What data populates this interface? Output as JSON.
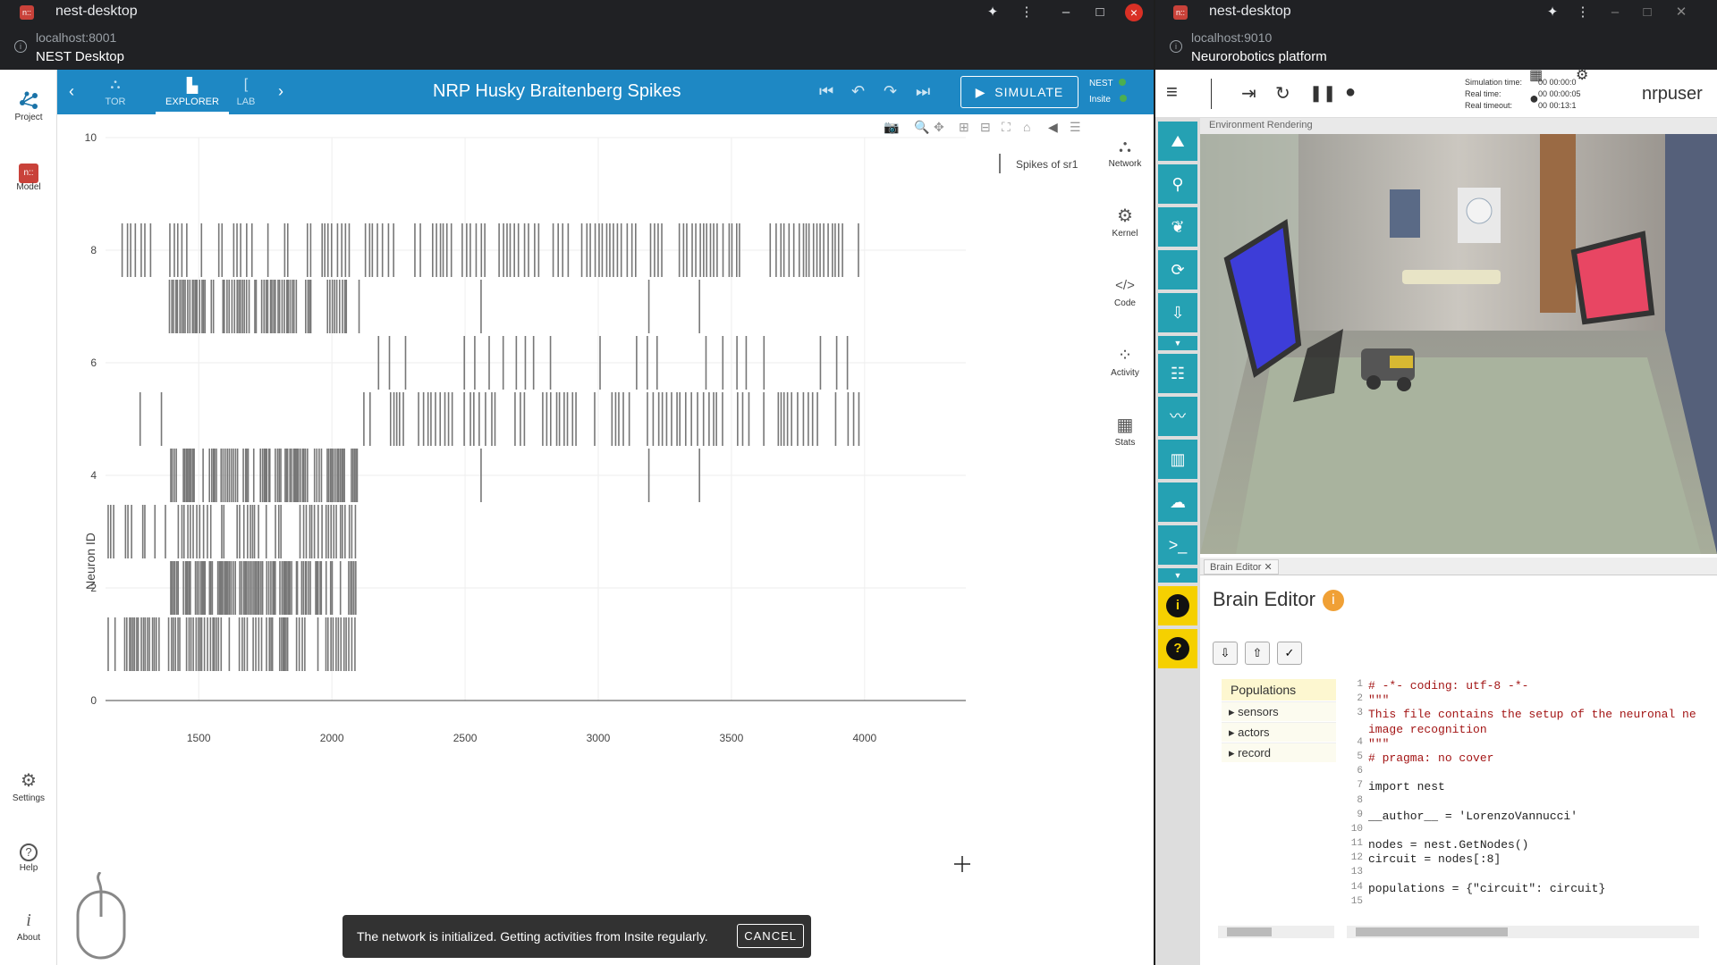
{
  "left_window": {
    "title": "nest-desktop",
    "host": "localhost:8001",
    "subtitle": "NEST Desktop",
    "rail": [
      {
        "label": "Project",
        "icon": "network-icon"
      },
      {
        "label": "Model",
        "icon": "nest-logo-icon"
      },
      {
        "label": "Settings",
        "icon": "gear-icon"
      },
      {
        "label": "Help",
        "icon": "help-icon"
      },
      {
        "label": "About",
        "icon": "info-icon"
      }
    ],
    "toolbar": {
      "nav": [
        {
          "label": "TOR"
        },
        {
          "label": "EXPLORER"
        },
        {
          "label": "LAB"
        }
      ],
      "title": "NRP Husky Braitenberg Spikes",
      "simulate": "SIMULATE",
      "status": [
        {
          "label": "NEST",
          "color": "#4caf50"
        },
        {
          "label": "Insite",
          "color": "#4caf50"
        }
      ]
    },
    "side_panel": [
      {
        "label": "Network",
        "icon": "network-icon"
      },
      {
        "label": "Kernel",
        "icon": "engine-icon"
      },
      {
        "label": "Code",
        "icon": "code-icon"
      },
      {
        "label": "Activity",
        "icon": "scatter-plot-icon"
      },
      {
        "label": "Stats",
        "icon": "table-icon"
      }
    ],
    "snackbar": {
      "message": "The network is initialized. Getting activities from Insite regularly.",
      "action": "CANCEL"
    }
  },
  "chart_data": {
    "type": "scatter",
    "mark": "spike raster (vertical ticks)",
    "legend": "Spikes of sr1",
    "ylabel": "Neuron ID",
    "xlabel": "",
    "xlim": [
      1150,
      4380
    ],
    "ylim": [
      0,
      10
    ],
    "x_ticks": [
      "1500",
      "2000",
      "2500",
      "3000",
      "3500",
      "4000"
    ],
    "y_ticks": [
      "0",
      "2",
      "4",
      "6",
      "8",
      "10"
    ],
    "color": "#777777",
    "neurons": [
      {
        "id": 1,
        "segments": [
          [
            1160,
            2095,
            110
          ]
        ]
      },
      {
        "id": 2,
        "segments": [
          [
            1395,
            2090,
            120
          ]
        ]
      },
      {
        "id": 3,
        "segments": [
          [
            1160,
            2100,
            80
          ]
        ]
      },
      {
        "id": 4,
        "segments": [
          [
            1395,
            2100,
            110
          ]
        ],
        "spikes": [
          2560,
          3190,
          3380
        ]
      },
      {
        "id": 5,
        "spikes": [
          1280,
          1360
        ],
        "segments": [
          [
            2120,
            4000,
            110
          ]
        ]
      },
      {
        "id": 6,
        "segments": [
          [
            2175,
            3950,
            35
          ]
        ]
      },
      {
        "id": 7,
        "segments": [
          [
            1390,
            2100,
            90
          ]
        ],
        "spikes": [
          2560,
          3190,
          3380
        ]
      },
      {
        "id": 8,
        "segments": [
          [
            1160,
            3980,
            170
          ]
        ]
      }
    ]
  },
  "right_window": {
    "title": "nest-desktop",
    "host": "localhost:9010",
    "subtitle": "Neurorobotics platform",
    "sim": {
      "sim_label": "Simulation time:",
      "sim_value": "00 00:00:0",
      "real_label": "Real time:",
      "real_value": "00 00:00:05",
      "timeout_label": "Real timeout:",
      "timeout_value": "00 00:13:1"
    },
    "user": "nrpuser",
    "env_title": "Environment Rendering",
    "brain_tab": "Brain Editor",
    "brain_title": "Brain Editor",
    "populations": {
      "header": "Populations",
      "items": [
        "sensors",
        "actors",
        "record"
      ]
    },
    "code": [
      {
        "n": "1",
        "t": "# -*- coding: utf-8 -*-"
      },
      {
        "n": "2",
        "t": "\"\"\""
      },
      {
        "n": "3",
        "t": "This file contains the setup of the neuronal ne"
      },
      {
        "n": "",
        "t": "image recognition"
      },
      {
        "n": "4",
        "t": "\"\"\""
      },
      {
        "n": "5",
        "t": "# pragma: no cover"
      },
      {
        "n": "6",
        "t": ""
      },
      {
        "n": "7",
        "t": "import nest"
      },
      {
        "n": "8",
        "t": ""
      },
      {
        "n": "9",
        "t": "__author__ = 'LorenzoVannucci'"
      },
      {
        "n": "10",
        "t": ""
      },
      {
        "n": "11",
        "t": "nodes = nest.GetNodes()"
      },
      {
        "n": "12",
        "t": "circuit = nodes[:8]"
      },
      {
        "n": "13",
        "t": ""
      },
      {
        "n": "14",
        "t": "populations = {\"circuit\": circuit}"
      },
      {
        "n": "15",
        "t": ""
      }
    ]
  }
}
